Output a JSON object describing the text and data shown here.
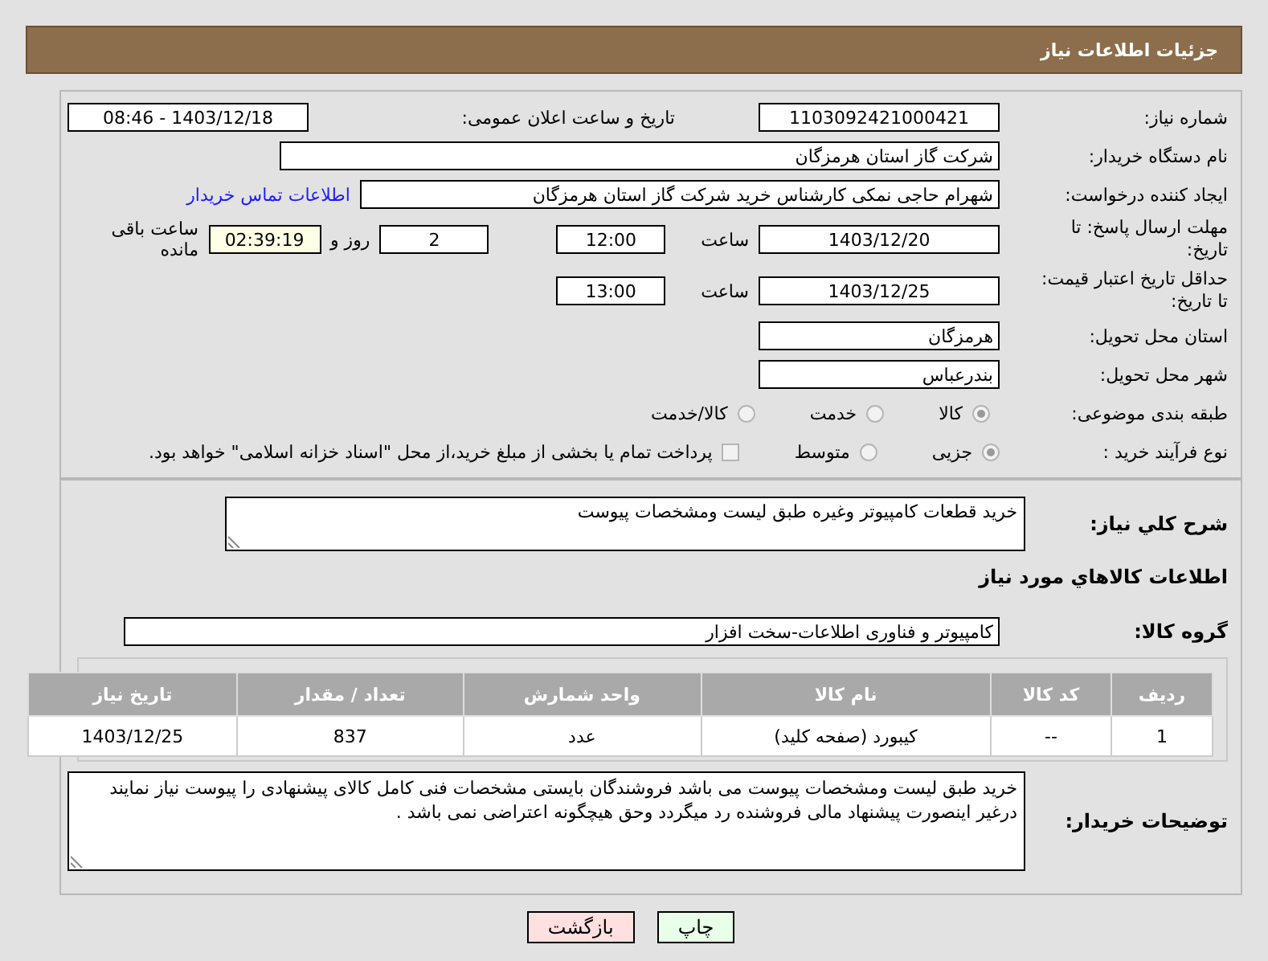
{
  "header": {
    "title": "جزئیات اطلاعات نیاز"
  },
  "need_number": {
    "label": "شماره نیاز:",
    "value": "1103092421000421"
  },
  "announce_datetime": {
    "label": "تاریخ و ساعت اعلان عمومی:",
    "value": "1403/12/18 - 08:46"
  },
  "buyer_org": {
    "label": "نام دستگاه خریدار:",
    "value": "شرکت گاز استان هرمزگان"
  },
  "requester": {
    "label": "ایجاد کننده درخواست:",
    "value": "شهرام حاجی نمکی کارشناس خرید شرکت گاز استان هرمزگان",
    "contact_link": "اطلاعات تماس خریدار"
  },
  "response_deadline": {
    "label": "مهلت ارسال پاسخ: تا تاریخ:",
    "date": "1403/12/20",
    "time_label": "ساعت",
    "time": "12:00",
    "days": "2",
    "days_label": "روز و",
    "remaining": "02:39:19",
    "remaining_label": "ساعت باقی مانده"
  },
  "price_validity": {
    "label": "حداقل تاریخ اعتبار قیمت: تا تاریخ:",
    "date": "1403/12/25",
    "time_label": "ساعت",
    "time": "13:00"
  },
  "province": {
    "label": "استان محل تحویل:",
    "value": "هرمزگان"
  },
  "city": {
    "label": "شهر محل تحویل:",
    "value": "بندرعباس"
  },
  "category": {
    "label": "طبقه بندی موضوعی:",
    "options": [
      {
        "label": "کالا",
        "selected": true
      },
      {
        "label": "خدمت",
        "selected": false
      },
      {
        "label": "کالا/خدمت",
        "selected": false
      }
    ]
  },
  "purchase_type": {
    "label": "نوع فرآیند خرید :",
    "options": [
      {
        "label": "جزیی",
        "selected": true
      },
      {
        "label": "متوسط",
        "selected": false
      }
    ],
    "treasury_payment": {
      "checked": false,
      "label": "پرداخت تمام یا بخشی از مبلغ خرید،از محل \"اسناد خزانه اسلامی\" خواهد بود."
    }
  },
  "description": {
    "label": "شرح کلي نیاز:",
    "value": "خرید قطعات کامپیوتر وغیره طبق لیست ومشخصات پیوست"
  },
  "items_heading": "اطلاعات کالاهاي مورد نياز",
  "goods_group": {
    "label": "گروه کالا:",
    "value": "کامپیوتر و فناوری اطلاعات-سخت افزار"
  },
  "table": {
    "columns": [
      "ردیف",
      "کد کالا",
      "نام کالا",
      "واحد شمارش",
      "تعداد / مقدار",
      "تاریخ نیاز"
    ],
    "rows": [
      [
        "1",
        "--",
        "کیبورد (صفحه کلید)",
        "عدد",
        "837",
        "1403/12/25"
      ]
    ]
  },
  "buyer_notes": {
    "label": "توضیحات خریدار:",
    "value": "خرید طبق لیست ومشخصات پیوست می باشد فروشندگان بایستی مشخصات فنی کامل کالای پیشنهادی را پیوست نیاز نمایند درغیر اینصورت پیشنهاد مالی فروشنده رد میگردد وحق هیچگونه اعتراضی نمی باشد ."
  },
  "buttons": [
    {
      "label": "چاپ",
      "kind": "print"
    },
    {
      "label": "بازگشت",
      "kind": "back"
    }
  ]
}
